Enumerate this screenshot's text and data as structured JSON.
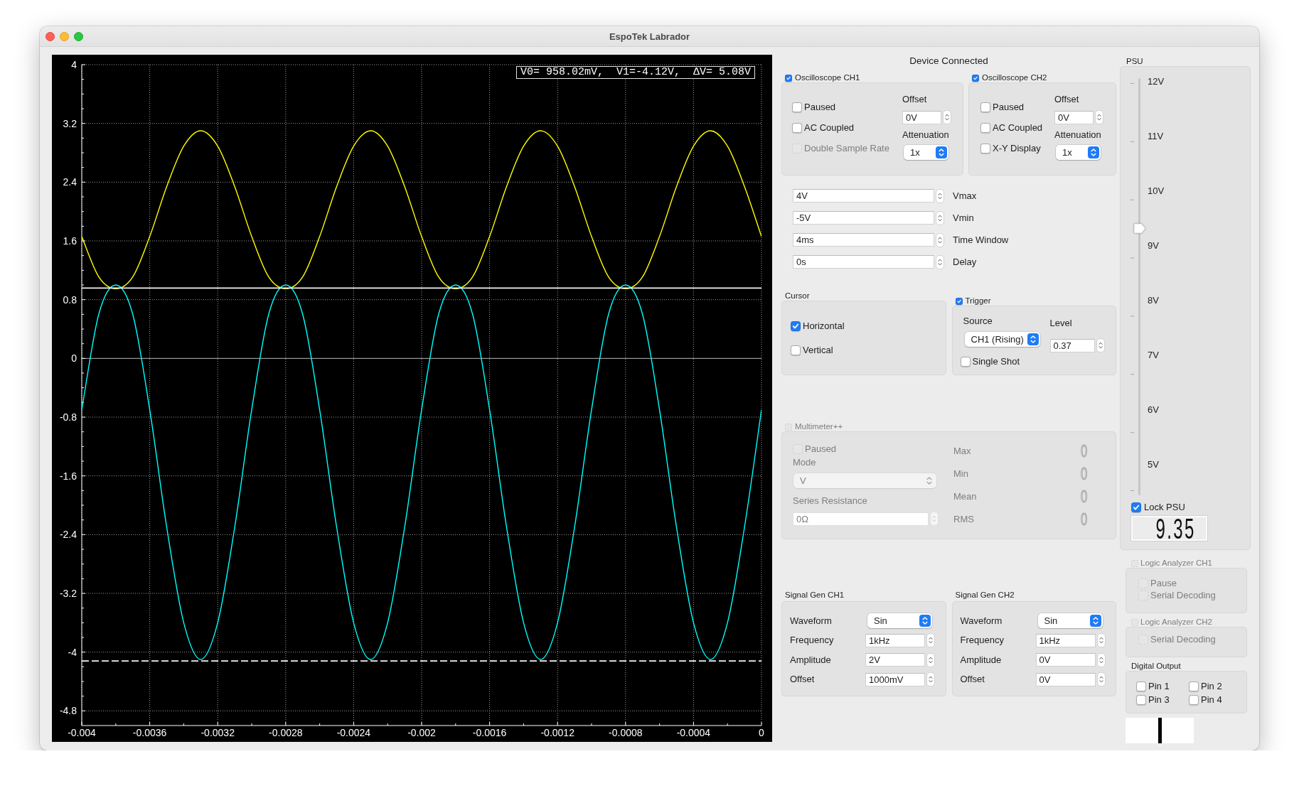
{
  "window": {
    "title": "EspoTek Labrador"
  },
  "plot": {
    "cursor_readout": "V0= 958.02mV,  V1=-4.12V,  ΔV= 5.08V",
    "chart_data": {
      "type": "line",
      "x": [
        -0.004,
        -0.0039,
        -0.0038,
        -0.0037,
        -0.0036,
        -0.0035,
        -0.0034,
        -0.0033,
        -0.0032,
        -0.0031,
        -0.003,
        -0.0029,
        -0.0028,
        -0.0027,
        -0.0026,
        -0.0025,
        -0.0024,
        -0.0023,
        -0.0022,
        -0.0021,
        -0.002,
        -0.0019,
        -0.0018,
        -0.0017,
        -0.0016,
        -0.0015,
        -0.0014,
        -0.0013,
        -0.0012,
        -0.0011,
        -0.001,
        -0.0009,
        -0.0008,
        -0.0007,
        -0.0006,
        -0.0005,
        -0.0004,
        -0.0003,
        -0.0002,
        -0.0001,
        0
      ],
      "series": [
        {
          "color": "#ffff00",
          "values": [
            1.66,
            1.11,
            0.95,
            1.11,
            1.66,
            2.34,
            2.89,
            3.1,
            2.89,
            2.34,
            1.66,
            1.11,
            0.95,
            1.11,
            1.66,
            2.34,
            2.89,
            3.1,
            2.89,
            2.34,
            1.66,
            1.11,
            0.95,
            1.11,
            1.66,
            2.34,
            2.89,
            3.1,
            2.89,
            2.34,
            1.66,
            1.11,
            0.95,
            1.11,
            1.66,
            2.34,
            2.89,
            3.1,
            2.89,
            2.34,
            1.66
          ]
        },
        {
          "color": "#00ffff",
          "values": [
            -0.7,
            0.6,
            1.0,
            0.6,
            -0.7,
            -2.3,
            -3.6,
            -4.1,
            -3.6,
            -2.3,
            -0.7,
            0.6,
            1.0,
            0.6,
            -0.7,
            -2.3,
            -3.6,
            -4.1,
            -3.6,
            -2.3,
            -0.7,
            0.6,
            1.0,
            0.6,
            -0.7,
            -2.3,
            -3.6,
            -4.1,
            -3.6,
            -2.3,
            -0.7,
            0.6,
            1.0,
            0.6,
            -0.7,
            -2.3,
            -3.6,
            -4.1,
            -3.6,
            -2.3,
            -0.7
          ]
        }
      ],
      "xlim": [
        -0.004,
        0
      ],
      "ylim": [
        -5,
        4
      ],
      "xticks": [
        -0.004,
        -0.0036,
        -0.0032,
        -0.0028,
        -0.0024,
        -0.002,
        -0.0016,
        -0.0012,
        -0.0008,
        -0.0004,
        0
      ],
      "yticks": [
        4,
        3.2,
        2.4,
        1.6,
        0.8,
        0,
        -0.8,
        -1.6,
        -2.4,
        -3.2,
        -4,
        -4.8
      ],
      "grid": true,
      "ref_lines": [
        {
          "axis": "y",
          "value": 0.958
        },
        {
          "axis": "y",
          "value": -4.12
        }
      ]
    }
  },
  "connection_status": "Device Connected",
  "oscilloscopes": [
    {
      "title": "Oscilloscope CH1",
      "checked": true,
      "options": [
        {
          "label": "Paused",
          "checked": false,
          "disabled": false
        },
        {
          "label": "AC Coupled",
          "checked": false,
          "disabled": false
        },
        {
          "label": "Double Sample Rate",
          "checked": false,
          "disabled": true
        }
      ],
      "offset_label": "Offset",
      "offset": "0V",
      "attenuation_label": "Attenuation",
      "attenuation": "1x"
    },
    {
      "title": "Oscilloscope CH2",
      "checked": true,
      "options": [
        {
          "label": "Paused",
          "checked": false,
          "disabled": false
        },
        {
          "label": "AC Coupled",
          "checked": false,
          "disabled": false
        },
        {
          "label": "X-Y Display",
          "checked": false,
          "disabled": false
        }
      ],
      "offset_label": "Offset",
      "offset": "0V",
      "attenuation_label": "Attenuation",
      "attenuation": "1x"
    }
  ],
  "scope_settings": [
    {
      "value": "4V",
      "label": "Vmax"
    },
    {
      "value": "-5V",
      "label": "Vmin"
    },
    {
      "value": "4ms",
      "label": "Time Window"
    },
    {
      "value": "0s",
      "label": "Delay"
    }
  ],
  "cursor": {
    "title": "Cursor",
    "options": [
      {
        "label": "Horizontal",
        "checked": true
      },
      {
        "label": "Vertical",
        "checked": false
      }
    ]
  },
  "trigger": {
    "title": "Trigger",
    "checked": true,
    "source_label": "Source",
    "source": "CH1 (Rising)",
    "level_label": "Level",
    "level_value": "0.37",
    "single_shot": {
      "label": "Single Shot",
      "checked": false
    }
  },
  "multimeter": {
    "title": "Multimeter++",
    "checked": false,
    "disabled": true,
    "paused": {
      "label": "Paused",
      "checked": false
    },
    "mode_label": "Mode",
    "mode": "V",
    "series_resistance_label": "Series Resistance",
    "series_resistance": "0Ω",
    "readings": [
      {
        "label": "Max",
        "value": "0"
      },
      {
        "label": "Min",
        "value": "0"
      },
      {
        "label": "Mean",
        "value": "0"
      },
      {
        "label": "RMS",
        "value": "0"
      }
    ]
  },
  "signal_generators": [
    {
      "title": "Signal Gen CH1",
      "rows": [
        {
          "kind": "dropdown",
          "label": "Waveform",
          "value": "Sin"
        },
        {
          "kind": "spinbox",
          "label": "Frequency",
          "value": "1kHz"
        },
        {
          "kind": "spinbox",
          "label": "Amplitude",
          "value": "2V"
        },
        {
          "kind": "spinbox",
          "label": "Offset",
          "value": "1000mV"
        }
      ]
    },
    {
      "title": "Signal Gen CH2",
      "rows": [
        {
          "kind": "dropdown",
          "label": "Waveform",
          "value": "Sin"
        },
        {
          "kind": "spinbox",
          "label": "Frequency",
          "value": "1kHz"
        },
        {
          "kind": "spinbox",
          "label": "Amplitude",
          "value": "0V"
        },
        {
          "kind": "spinbox",
          "label": "Offset",
          "value": "0V"
        }
      ]
    }
  ],
  "psu": {
    "title": "PSU",
    "scale": [
      "12V",
      "11V",
      "10V",
      "9V",
      "8V",
      "7V",
      "6V",
      "5V"
    ],
    "level": 0.64,
    "lock": {
      "label": "Lock PSU",
      "checked": true
    },
    "display": "9.35"
  },
  "logic_analyzers": [
    {
      "title": "Logic Analyzer CH1",
      "checked": false,
      "disabled": true,
      "options": [
        {
          "label": "Pause",
          "checked": false
        },
        {
          "label": "Serial Decoding",
          "checked": false
        }
      ]
    },
    {
      "title": "Logic Analyzer CH2",
      "checked": false,
      "disabled": true,
      "options": [
        {
          "label": "Serial Decoding",
          "checked": false
        }
      ]
    }
  ],
  "digital_output": {
    "title": "Digital Output",
    "pins": [
      {
        "label": "Pin 1",
        "checked": false
      },
      {
        "label": "Pin 2",
        "checked": false
      },
      {
        "label": "Pin 3",
        "checked": false
      },
      {
        "label": "Pin 4",
        "checked": false
      }
    ]
  }
}
